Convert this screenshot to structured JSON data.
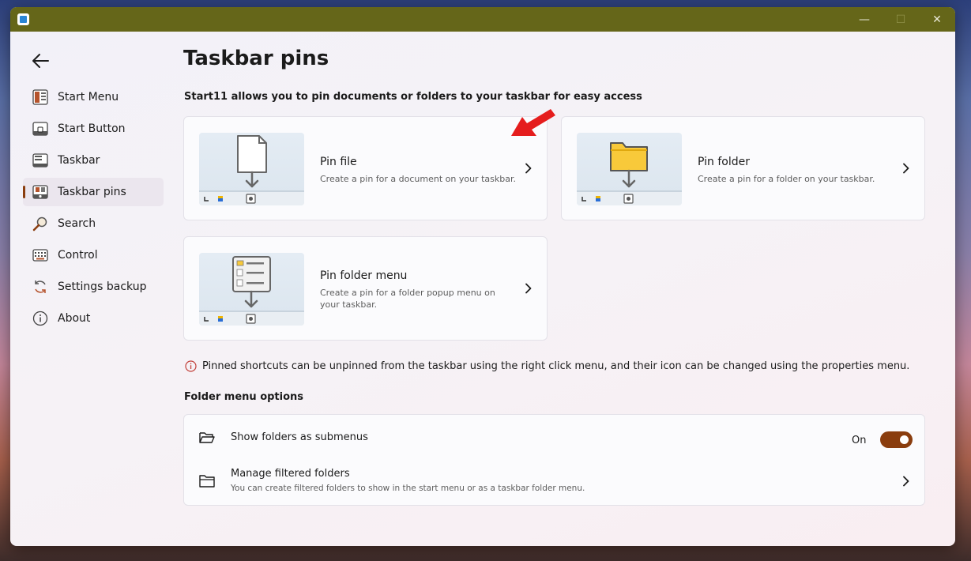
{
  "window": {
    "controls": {
      "minimize": "—",
      "maximize": "☐",
      "close": "✕"
    }
  },
  "sidebar": {
    "items": [
      {
        "label": "Start Menu",
        "icon": "start-menu-icon"
      },
      {
        "label": "Start Button",
        "icon": "start-button-icon"
      },
      {
        "label": "Taskbar",
        "icon": "taskbar-icon"
      },
      {
        "label": "Taskbar pins",
        "icon": "taskbar-pins-icon",
        "active": true
      },
      {
        "label": "Search",
        "icon": "search-icon"
      },
      {
        "label": "Control",
        "icon": "keyboard-icon"
      },
      {
        "label": "Settings backup",
        "icon": "sync-icon"
      },
      {
        "label": "About",
        "icon": "info-icon"
      }
    ]
  },
  "main": {
    "title": "Taskbar pins",
    "subtitle": "Start11 allows you to pin documents or folders to your taskbar for easy access",
    "cards": {
      "pin_file": {
        "title": "Pin file",
        "desc": "Create a pin for a document on your taskbar."
      },
      "pin_folder": {
        "title": "Pin folder",
        "desc": "Create a pin for a folder on your taskbar."
      },
      "pin_folder_menu": {
        "title": "Pin folder menu",
        "desc": "Create a pin for a folder popup menu on your taskbar."
      }
    },
    "info_text": "Pinned shortcuts can be unpinned from the taskbar using the right click menu, and their icon can be changed using the properties menu.",
    "folder_menu_options": {
      "title": "Folder menu options",
      "show_submenus": {
        "title": "Show folders as submenus",
        "state_label": "On",
        "enabled": true
      },
      "manage_filtered": {
        "title": "Manage filtered folders",
        "desc": "You can create filtered folders to show in the start menu or as a taskbar folder menu."
      }
    }
  },
  "colors": {
    "titlebar": "#656619",
    "accent": "#8a3d0e",
    "annotation_arrow": "#e51d1d"
  }
}
